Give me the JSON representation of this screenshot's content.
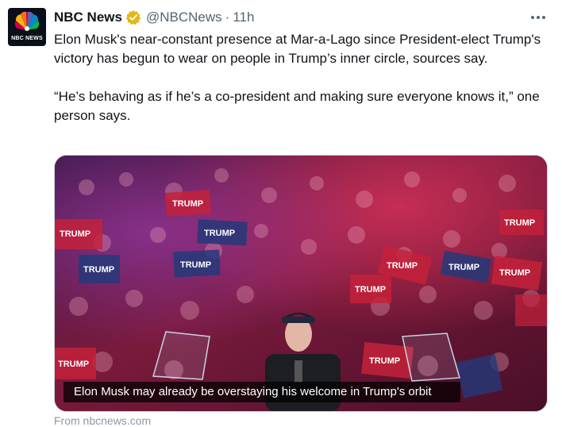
{
  "account": {
    "display_name": "NBC News",
    "handle": "@NBCNews",
    "separator": "·",
    "time": "11h",
    "avatar_text": "NBC NEWS",
    "verified": true
  },
  "tweet": {
    "paragraphs": [
      "Elon Musk's near-constant presence at Mar-a-Lago since President-elect Trump's victory has begun to wear on people in Trump’s inner circle, sources say.",
      "“He’s behaving as if he’s a co-president and making sure everyone knows it,” one person says."
    ]
  },
  "media": {
    "caption": "Elon Musk may already be overstaying his welcome in Trump's orbit",
    "signs": [
      "TRUMP",
      "TRUMP",
      "TRUMP",
      "TRUMP",
      "TRUMP",
      "TRUMP",
      "TRUMP",
      "TRUMP",
      "TRUMP",
      "TRUMP",
      "TRUMP",
      "TRUMP"
    ]
  },
  "link_card": {
    "source": "From nbcnews.com"
  },
  "icons": {
    "more": "more-horizontal-icon",
    "verified": "verified-badge-icon",
    "logo": "nbc-peacock-icon"
  },
  "colors": {
    "text": "#0f1419",
    "muted": "#536471",
    "verified_gold": "#e2b719",
    "crowd_red": "#c4213a",
    "crowd_purple": "#2a0f3a"
  }
}
